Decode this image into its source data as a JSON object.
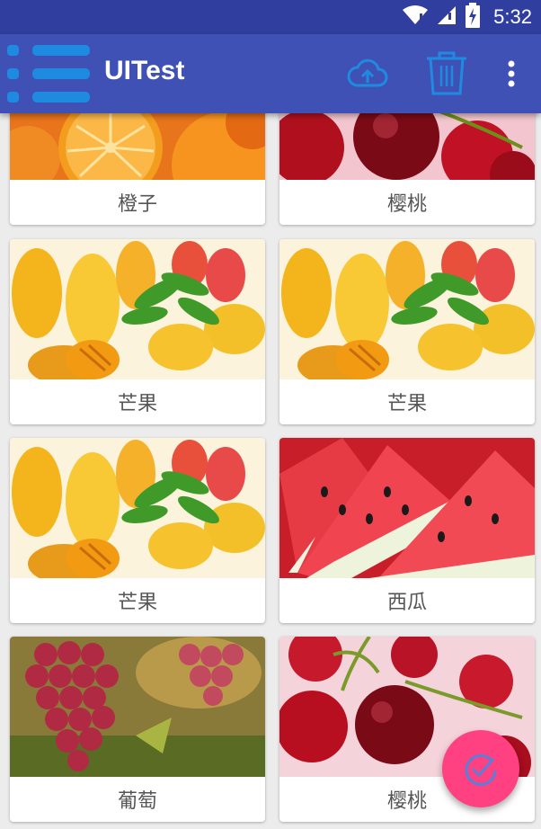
{
  "status_bar": {
    "time": "5:32",
    "icons": [
      "wifi-icon",
      "signal-icon",
      "battery-charging-icon"
    ]
  },
  "toolbar": {
    "title": "UITest",
    "background": "#3f51b5",
    "actions": [
      "menu-icon",
      "cloud-upload-icon",
      "trash-icon",
      "more-vert-icon"
    ]
  },
  "cards": [
    {
      "label": "橙子",
      "fruit": "orange"
    },
    {
      "label": "樱桃",
      "fruit": "cherry"
    },
    {
      "label": "芒果",
      "fruit": "mango"
    },
    {
      "label": "芒果",
      "fruit": "mango"
    },
    {
      "label": "芒果",
      "fruit": "mango"
    },
    {
      "label": "西瓜",
      "fruit": "watermelon"
    },
    {
      "label": "葡萄",
      "fruit": "grape"
    },
    {
      "label": "樱桃",
      "fruit": "cherry"
    }
  ],
  "fab": {
    "icon": "check-circle-icon",
    "color": "#ff4081"
  }
}
